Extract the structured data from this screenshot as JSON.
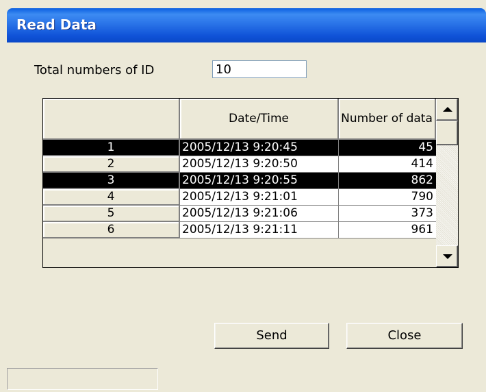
{
  "window": {
    "title": "Read Data"
  },
  "total": {
    "label": "Total numbers of ID",
    "value": "10"
  },
  "grid": {
    "headers": {
      "corner": "",
      "date_time": "Date/Time",
      "number_of_data": "Number of data"
    },
    "rows": [
      {
        "id": "1",
        "datetime": "2005/12/13 9:20:45",
        "count": "45",
        "selected": true
      },
      {
        "id": "2",
        "datetime": "2005/12/13 9:20:50",
        "count": "414",
        "selected": false
      },
      {
        "id": "3",
        "datetime": "2005/12/13 9:20:55",
        "count": "862",
        "selected": true
      },
      {
        "id": "4",
        "datetime": "2005/12/13 9:21:01",
        "count": "790",
        "selected": false
      },
      {
        "id": "5",
        "datetime": "2005/12/13 9:21:06",
        "count": "373",
        "selected": false
      },
      {
        "id": "6",
        "datetime": "2005/12/13 9:21:11",
        "count": "961",
        "selected": false
      }
    ]
  },
  "buttons": {
    "send": "Send",
    "close": "Close"
  },
  "colors": {
    "titlebar": "#2a74e8",
    "selection": "#000000",
    "face": "#ece9d8"
  }
}
